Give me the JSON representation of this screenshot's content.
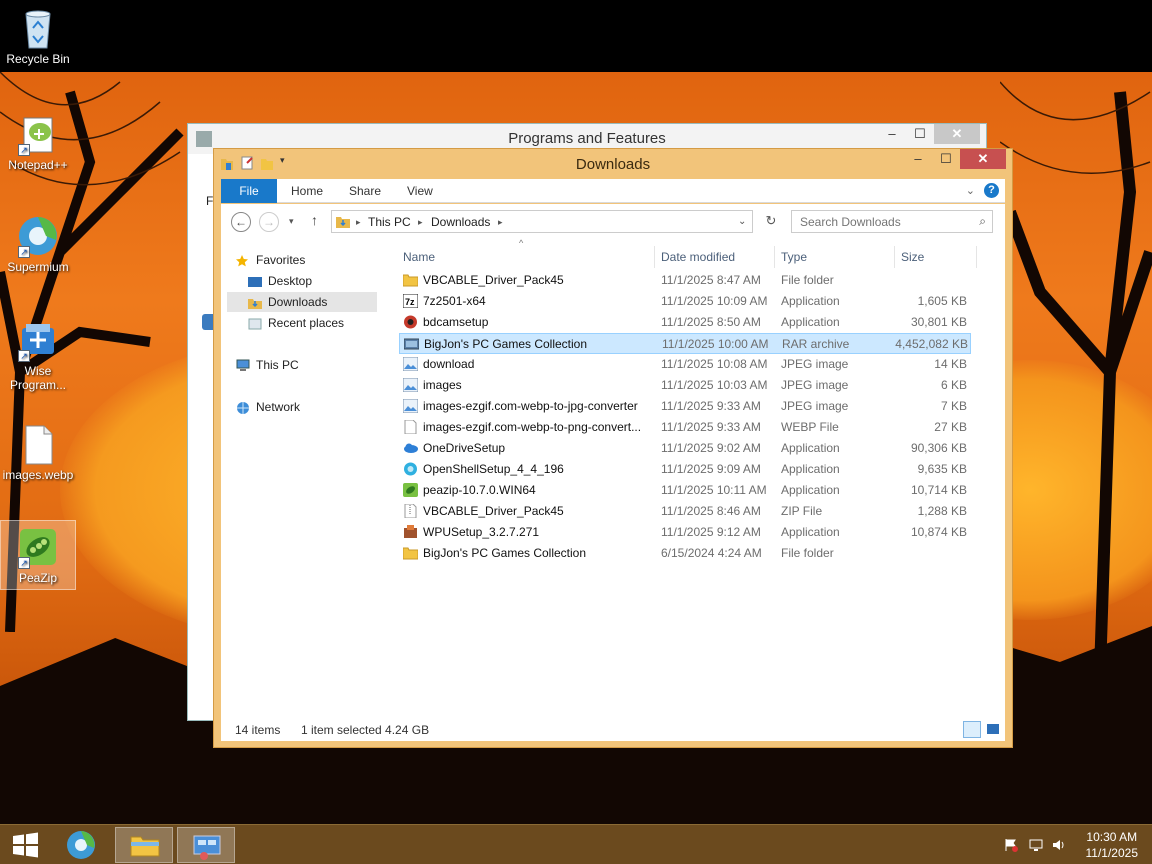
{
  "desktop": {
    "icons": [
      {
        "label": "Recycle Bin",
        "icon": "recycle-bin-icon"
      },
      {
        "label": "Notepad++",
        "icon": "notepad-plus-plus-icon"
      },
      {
        "label": "Supermium",
        "icon": "supermium-browser-icon"
      },
      {
        "label": "Wise Program...",
        "icon": "wise-program-uninstaller-icon"
      },
      {
        "label": "images.webp",
        "icon": "file-icon"
      },
      {
        "label": "PeaZip",
        "icon": "peazip-icon"
      }
    ]
  },
  "back_window": {
    "title": "Programs and Features",
    "edge_text": "Fi"
  },
  "window": {
    "title": "Downloads",
    "ribbon_tabs": [
      "File",
      "Home",
      "Share",
      "View"
    ],
    "breadcrumb": [
      "This PC",
      "Downloads"
    ],
    "search_placeholder": "Search Downloads",
    "nav": {
      "favorites": "Favorites",
      "desktop": "Desktop",
      "downloads": "Downloads",
      "recent": "Recent places",
      "this_pc": "This PC",
      "network": "Network"
    },
    "columns": {
      "name": "Name",
      "date": "Date modified",
      "type": "Type",
      "size": "Size"
    },
    "files": [
      {
        "name": "VBCABLE_Driver_Pack45",
        "date": "11/1/2025 8:47 AM",
        "type": "File folder",
        "size": "",
        "icon": "folder-icon"
      },
      {
        "name": "7z2501-x64",
        "date": "11/1/2025 10:09 AM",
        "type": "Application",
        "size": "1,605 KB",
        "icon": "7zip-icon"
      },
      {
        "name": "bdcamsetup",
        "date": "11/1/2025 8:50 AM",
        "type": "Application",
        "size": "30,801 KB",
        "icon": "bandicam-icon"
      },
      {
        "name": "BigJon's PC Games Collection",
        "date": "11/1/2025 10:00 AM",
        "type": "RAR archive",
        "size": "4,452,082 KB",
        "icon": "rar-archive-icon",
        "selected": true
      },
      {
        "name": "download",
        "date": "11/1/2025 10:08 AM",
        "type": "JPEG image",
        "size": "14 KB",
        "icon": "image-file-icon"
      },
      {
        "name": "images",
        "date": "11/1/2025 10:03 AM",
        "type": "JPEG image",
        "size": "6 KB",
        "icon": "image-file-icon"
      },
      {
        "name": "images-ezgif.com-webp-to-jpg-converter",
        "date": "11/1/2025 9:33 AM",
        "type": "JPEG image",
        "size": "7 KB",
        "icon": "image-file-icon"
      },
      {
        "name": "images-ezgif.com-webp-to-png-convert...",
        "date": "11/1/2025 9:33 AM",
        "type": "WEBP File",
        "size": "27 KB",
        "icon": "file-icon"
      },
      {
        "name": "OneDriveSetup",
        "date": "11/1/2025 9:02 AM",
        "type": "Application",
        "size": "90,306 KB",
        "icon": "onedrive-icon"
      },
      {
        "name": "OpenShellSetup_4_4_196",
        "date": "11/1/2025 9:09 AM",
        "type": "Application",
        "size": "9,635 KB",
        "icon": "openshell-icon"
      },
      {
        "name": "peazip-10.7.0.WIN64",
        "date": "11/1/2025 10:11 AM",
        "type": "Application",
        "size": "10,714 KB",
        "icon": "peazip-icon"
      },
      {
        "name": "VBCABLE_Driver_Pack45",
        "date": "11/1/2025 8:46 AM",
        "type": "ZIP File",
        "size": "1,288 KB",
        "icon": "zip-file-icon"
      },
      {
        "name": "WPUSetup_3.2.7.271",
        "date": "11/1/2025 9:12 AM",
        "type": "Application",
        "size": "10,874 KB",
        "icon": "installer-icon"
      },
      {
        "name": "BigJon's PC Games Collection",
        "date": "6/15/2024 4:24 AM",
        "type": "File folder",
        "size": "",
        "icon": "folder-icon"
      }
    ],
    "status": {
      "items": "14 items",
      "selected": "1 item selected  4.24 GB"
    }
  },
  "taskbar": {
    "items": [
      "start-button",
      "supermium-browser-icon",
      "file-explorer-icon",
      "control-panel-icon"
    ],
    "time": "10:30 AM",
    "date": "11/1/2025"
  },
  "colors": {
    "accent_orange": "#f2c47a",
    "selection": "#cce8ff",
    "file_tab": "#1979ca",
    "close_button": "#c75050",
    "taskbar": "#6b4a1e"
  }
}
